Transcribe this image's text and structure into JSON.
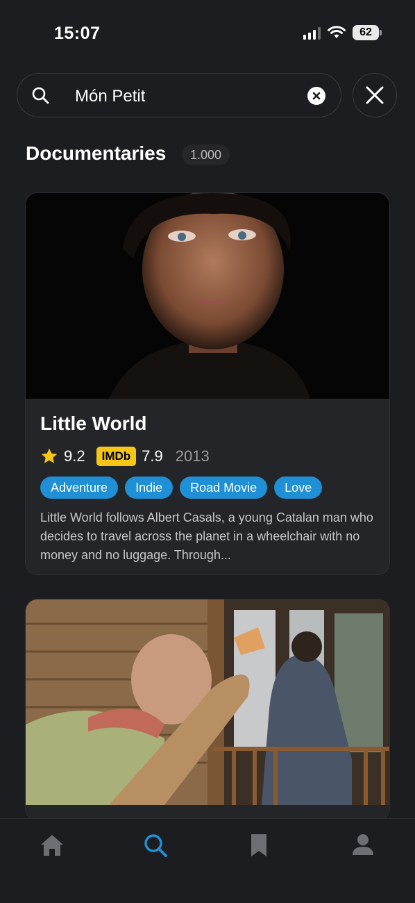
{
  "status_bar": {
    "time": "15:07",
    "battery": "62",
    "icons": [
      "signal-icon",
      "wifi-icon",
      "battery-icon"
    ]
  },
  "search": {
    "value": "Món Petit",
    "icons": [
      "search-icon",
      "clear-icon",
      "close-icon"
    ]
  },
  "section": {
    "title": "Documentaries",
    "count": "1.000"
  },
  "results": [
    {
      "title": "Little World",
      "rating": "9.2",
      "imdb_label": "IMDb",
      "imdb_rating": "7.9",
      "year": "2013",
      "tags": [
        "Adventure",
        "Indie",
        "Road Movie",
        "Love"
      ],
      "description": "Little World follows Albert Casals, a young Catalan man who decides to travel across the planet in a wheelchair with no money and no luggage. Through..."
    },
    {
      "title": ""
    }
  ],
  "tab_bar": {
    "tabs": [
      "home-icon",
      "search-icon",
      "bookmark-icon",
      "profile-icon"
    ],
    "active": "search-icon"
  },
  "colors": {
    "background": "#1c1d20",
    "card": "#242528",
    "accent": "#1f8fd6",
    "imdb": "#f5c518",
    "star": "#f5c518"
  }
}
